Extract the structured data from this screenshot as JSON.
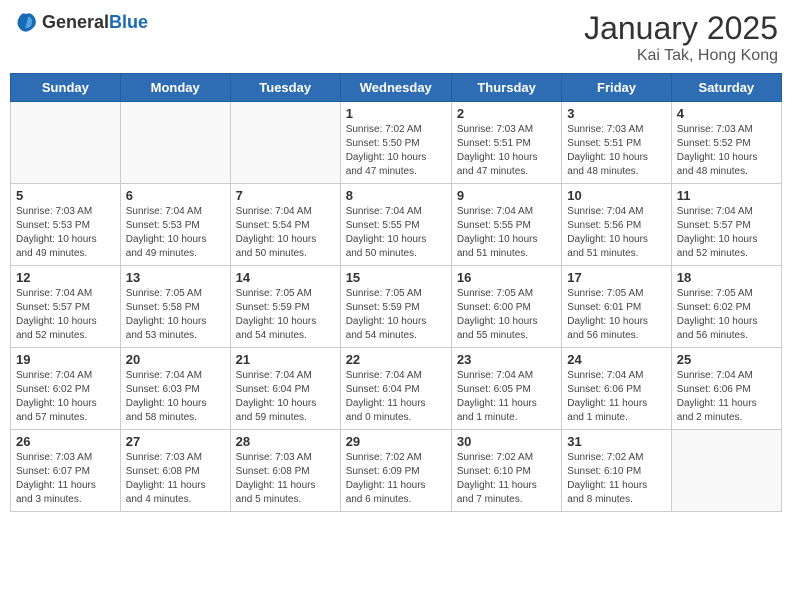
{
  "header": {
    "logo_general": "General",
    "logo_blue": "Blue",
    "month": "January 2025",
    "location": "Kai Tak, Hong Kong"
  },
  "weekdays": [
    "Sunday",
    "Monday",
    "Tuesday",
    "Wednesday",
    "Thursday",
    "Friday",
    "Saturday"
  ],
  "weeks": [
    [
      {
        "day": "",
        "info": ""
      },
      {
        "day": "",
        "info": ""
      },
      {
        "day": "",
        "info": ""
      },
      {
        "day": "1",
        "info": "Sunrise: 7:02 AM\nSunset: 5:50 PM\nDaylight: 10 hours\nand 47 minutes."
      },
      {
        "day": "2",
        "info": "Sunrise: 7:03 AM\nSunset: 5:51 PM\nDaylight: 10 hours\nand 47 minutes."
      },
      {
        "day": "3",
        "info": "Sunrise: 7:03 AM\nSunset: 5:51 PM\nDaylight: 10 hours\nand 48 minutes."
      },
      {
        "day": "4",
        "info": "Sunrise: 7:03 AM\nSunset: 5:52 PM\nDaylight: 10 hours\nand 48 minutes."
      }
    ],
    [
      {
        "day": "5",
        "info": "Sunrise: 7:03 AM\nSunset: 5:53 PM\nDaylight: 10 hours\nand 49 minutes."
      },
      {
        "day": "6",
        "info": "Sunrise: 7:04 AM\nSunset: 5:53 PM\nDaylight: 10 hours\nand 49 minutes."
      },
      {
        "day": "7",
        "info": "Sunrise: 7:04 AM\nSunset: 5:54 PM\nDaylight: 10 hours\nand 50 minutes."
      },
      {
        "day": "8",
        "info": "Sunrise: 7:04 AM\nSunset: 5:55 PM\nDaylight: 10 hours\nand 50 minutes."
      },
      {
        "day": "9",
        "info": "Sunrise: 7:04 AM\nSunset: 5:55 PM\nDaylight: 10 hours\nand 51 minutes."
      },
      {
        "day": "10",
        "info": "Sunrise: 7:04 AM\nSunset: 5:56 PM\nDaylight: 10 hours\nand 51 minutes."
      },
      {
        "day": "11",
        "info": "Sunrise: 7:04 AM\nSunset: 5:57 PM\nDaylight: 10 hours\nand 52 minutes."
      }
    ],
    [
      {
        "day": "12",
        "info": "Sunrise: 7:04 AM\nSunset: 5:57 PM\nDaylight: 10 hours\nand 52 minutes."
      },
      {
        "day": "13",
        "info": "Sunrise: 7:05 AM\nSunset: 5:58 PM\nDaylight: 10 hours\nand 53 minutes."
      },
      {
        "day": "14",
        "info": "Sunrise: 7:05 AM\nSunset: 5:59 PM\nDaylight: 10 hours\nand 54 minutes."
      },
      {
        "day": "15",
        "info": "Sunrise: 7:05 AM\nSunset: 5:59 PM\nDaylight: 10 hours\nand 54 minutes."
      },
      {
        "day": "16",
        "info": "Sunrise: 7:05 AM\nSunset: 6:00 PM\nDaylight: 10 hours\nand 55 minutes."
      },
      {
        "day": "17",
        "info": "Sunrise: 7:05 AM\nSunset: 6:01 PM\nDaylight: 10 hours\nand 56 minutes."
      },
      {
        "day": "18",
        "info": "Sunrise: 7:05 AM\nSunset: 6:02 PM\nDaylight: 10 hours\nand 56 minutes."
      }
    ],
    [
      {
        "day": "19",
        "info": "Sunrise: 7:04 AM\nSunset: 6:02 PM\nDaylight: 10 hours\nand 57 minutes."
      },
      {
        "day": "20",
        "info": "Sunrise: 7:04 AM\nSunset: 6:03 PM\nDaylight: 10 hours\nand 58 minutes."
      },
      {
        "day": "21",
        "info": "Sunrise: 7:04 AM\nSunset: 6:04 PM\nDaylight: 10 hours\nand 59 minutes."
      },
      {
        "day": "22",
        "info": "Sunrise: 7:04 AM\nSunset: 6:04 PM\nDaylight: 11 hours\nand 0 minutes."
      },
      {
        "day": "23",
        "info": "Sunrise: 7:04 AM\nSunset: 6:05 PM\nDaylight: 11 hours\nand 1 minute."
      },
      {
        "day": "24",
        "info": "Sunrise: 7:04 AM\nSunset: 6:06 PM\nDaylight: 11 hours\nand 1 minute."
      },
      {
        "day": "25",
        "info": "Sunrise: 7:04 AM\nSunset: 6:06 PM\nDaylight: 11 hours\nand 2 minutes."
      }
    ],
    [
      {
        "day": "26",
        "info": "Sunrise: 7:03 AM\nSunset: 6:07 PM\nDaylight: 11 hours\nand 3 minutes."
      },
      {
        "day": "27",
        "info": "Sunrise: 7:03 AM\nSunset: 6:08 PM\nDaylight: 11 hours\nand 4 minutes."
      },
      {
        "day": "28",
        "info": "Sunrise: 7:03 AM\nSunset: 6:08 PM\nDaylight: 11 hours\nand 5 minutes."
      },
      {
        "day": "29",
        "info": "Sunrise: 7:02 AM\nSunset: 6:09 PM\nDaylight: 11 hours\nand 6 minutes."
      },
      {
        "day": "30",
        "info": "Sunrise: 7:02 AM\nSunset: 6:10 PM\nDaylight: 11 hours\nand 7 minutes."
      },
      {
        "day": "31",
        "info": "Sunrise: 7:02 AM\nSunset: 6:10 PM\nDaylight: 11 hours\nand 8 minutes."
      },
      {
        "day": "",
        "info": ""
      }
    ]
  ]
}
